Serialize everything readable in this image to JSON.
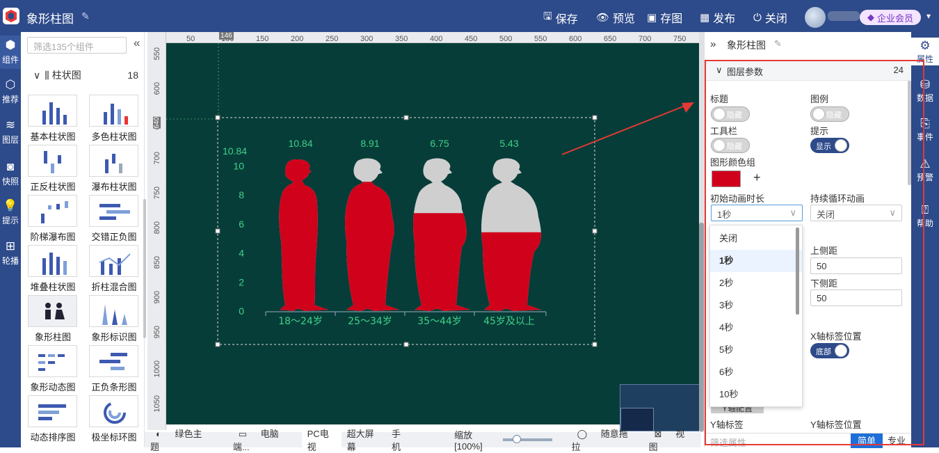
{
  "app": {
    "title": "象形柱图"
  },
  "toolbar": {
    "save": "保存",
    "preview": "预览",
    "saveimg": "存图",
    "publish": "发布",
    "close": "关闭",
    "vip": "企业会员"
  },
  "leftnav": [
    {
      "label": "组件",
      "icon": "component-icon"
    },
    {
      "label": "推荐",
      "icon": "recommend-icon"
    },
    {
      "label": "图层",
      "icon": "layers-icon"
    },
    {
      "label": "快照",
      "icon": "camera-icon"
    },
    {
      "label": "提示",
      "icon": "tip-icon"
    },
    {
      "label": "轮播",
      "icon": "carousel-icon"
    }
  ],
  "components": {
    "search_placeholder": "筛选135个组件",
    "category": "柱状图",
    "count": "18",
    "tiles": [
      "基本柱状图",
      "多色柱状图",
      "正反柱状图",
      "瀑布柱状图",
      "阶梯瀑布图",
      "交错正负图",
      "堆叠柱状图",
      "折柱混合图",
      "象形柱图",
      "象形标识图",
      "象形动态图",
      "正负条形图",
      "动态排序图",
      "极坐标环图"
    ]
  },
  "ruler": {
    "top": [
      "50",
      "100",
      "150",
      "200",
      "250",
      "300",
      "350",
      "400",
      "450",
      "500",
      "550",
      "600",
      "650",
      "700",
      "750"
    ],
    "left": [
      "550",
      "600",
      "650",
      "700",
      "750",
      "800",
      "850",
      "900",
      "950",
      "1000",
      "1050"
    ],
    "marker_top": "146",
    "marker_left": "640"
  },
  "chart_data": {
    "type": "bar",
    "categories": [
      "18～24岁",
      "25～34岁",
      "35～44岁",
      "45岁及以上"
    ],
    "values": [
      10.84,
      8.91,
      6.75,
      5.43
    ],
    "ylim": [
      0,
      10.84
    ],
    "yticks": [
      "0",
      "2",
      "4",
      "6",
      "8",
      "10"
    ],
    "ymax_label": "10.84",
    "colors": {
      "fill": "#d0021b",
      "empty": "#cfcfcf",
      "text": "#3fd28a",
      "bg": "#073d38"
    }
  },
  "bottom": {
    "theme": "绿色主题",
    "tabs": [
      "电脑端...",
      "PC电视",
      "超大屏幕",
      "手机"
    ],
    "zoom": "缩放[100%]",
    "drag": "随意拖拉",
    "view": "视图"
  },
  "rpanel": {
    "title": "象形柱图",
    "section": "图层参数",
    "count": "24",
    "labels": {
      "title": "标题",
      "legend": "图例",
      "toolbar": "工具栏",
      "tooltip": "提示",
      "colorgroup": "图形颜色组",
      "anim": "初始动画时长",
      "loop": "持续循环动画",
      "top": "上侧距",
      "bottom": "下侧距",
      "xpos": "X轴标签位置",
      "yaxis": "Y轴标签",
      "ypos": "Y轴标签位置",
      "yconfig": "Y轴配置"
    },
    "toggles": {
      "hide": "隐藏",
      "show": "显示",
      "bottom": "底部"
    },
    "anim_value": "1秒",
    "loop_value": "关闭",
    "top_value": "50",
    "bottom_value": "50",
    "dropdown": [
      "关闭",
      "1秒",
      "2秒",
      "3秒",
      "4秒",
      "5秒",
      "6秒",
      "10秒"
    ],
    "filter_placeholder": "筛选属性",
    "simple": "简单",
    "pro": "专业"
  },
  "rightnav": [
    {
      "label": "属性",
      "icon": "properties-icon"
    },
    {
      "label": "数据",
      "icon": "database-icon"
    },
    {
      "label": "事件",
      "icon": "event-icon"
    },
    {
      "label": "预警",
      "icon": "alarm-icon"
    },
    {
      "label": "帮助",
      "icon": "help-icon"
    }
  ]
}
